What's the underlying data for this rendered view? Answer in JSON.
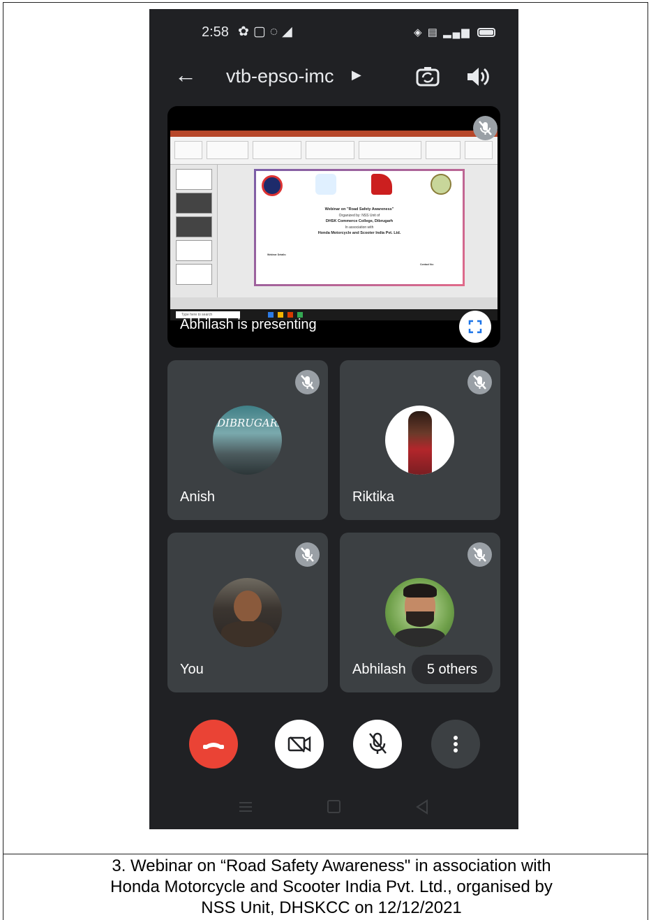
{
  "status_bar": {
    "time": "2:58",
    "left_icons": [
      "gear-icon",
      "cast-icon",
      "whatsapp-icon",
      "telegram-icon"
    ],
    "right_icons": [
      "hotspot-icon",
      "volte-icon",
      "signal-icon",
      "battery-icon"
    ]
  },
  "top_bar": {
    "meeting_code": "vtb-epso-imc"
  },
  "presentation": {
    "presenter_label": "Abhilash is presenting",
    "slide": {
      "title": "Webinar on \"Road Safety Awareness\"",
      "organized_by": "Organized by: NSS Unit of",
      "college": "DHSK Commerce College, Dibrugarh",
      "in_association": "In association with",
      "partner": "Honda Motorcycle and Scooter India Pvt. Ltd.",
      "details_heading": "Webinar Details:",
      "contact_heading": "Contact No:",
      "taskbar_search": "Type here to search"
    }
  },
  "participants": [
    {
      "name": "Anish",
      "avatar_text": "DIBRUGARH"
    },
    {
      "name": "Riktika"
    },
    {
      "name": "You"
    },
    {
      "name": "Abhilash",
      "others_label": "5 others"
    }
  ],
  "colors": {
    "app_bg": "#202124",
    "tile_bg": "#3c4043",
    "end_call": "#ea4335",
    "mute_badge": "#9aa0a6"
  },
  "caption": {
    "line1": "3.  Webinar on “Road Safety Awareness\" in association with",
    "line2": "Honda Motorcycle and Scooter India Pvt. Ltd., organised by",
    "line3": "NSS Unit, DHSKCC on 12/12/2021"
  }
}
